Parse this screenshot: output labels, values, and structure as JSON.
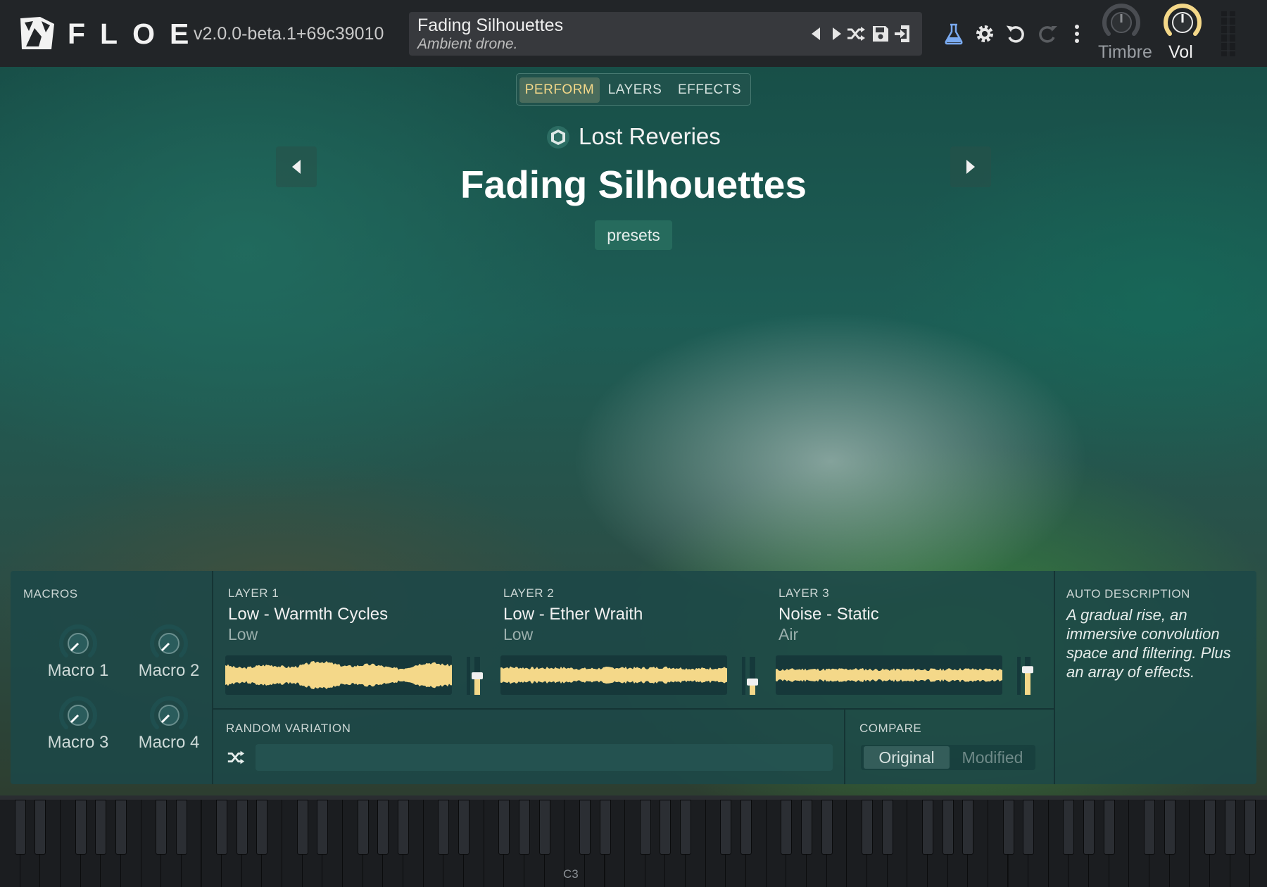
{
  "app": {
    "logo_text": "FLOE",
    "version": "v2.0.0-beta.1+69c39010"
  },
  "preset": {
    "name": "Fading Silhouettes",
    "description": "Ambient drone."
  },
  "toolbar_icons": [
    "triangle-left-icon",
    "triangle-right-icon",
    "shuffle-icon",
    "save-icon",
    "import-icon",
    "flask-icon",
    "gear-icon",
    "undo-icon",
    "redo-icon",
    "more-vertical-icon"
  ],
  "top_knobs": [
    {
      "label": "Timbre",
      "active": false
    },
    {
      "label": "Vol",
      "active": true
    }
  ],
  "tabs": [
    {
      "label": "PERFORM",
      "selected": true
    },
    {
      "label": "LAYERS",
      "selected": false
    },
    {
      "label": "EFFECTS",
      "selected": false
    }
  ],
  "hero": {
    "library": "Lost Reveries",
    "title": "Fading Silhouettes",
    "presets_label": "presets"
  },
  "macros": {
    "label": "MACROS",
    "items": [
      "Macro 1",
      "Macro 2",
      "Macro 3",
      "Macro 4"
    ]
  },
  "layers": [
    {
      "label": "LAYER 1",
      "name": "Low - Warmth Cycles",
      "sub": "Low",
      "level": 0.5
    },
    {
      "label": "LAYER 2",
      "name": "Low - Ether Wraith",
      "sub": "Low",
      "level": 0.3
    },
    {
      "label": "LAYER 3",
      "name": "Noise - Static",
      "sub": "Air",
      "level": 0.7
    }
  ],
  "random_variation": {
    "label": "RANDOM VARIATION"
  },
  "compare": {
    "label": "COMPARE",
    "original": "Original",
    "modified": "Modified"
  },
  "auto_description": {
    "label": "AUTO DESCRIPTION",
    "text": "A gradual rise, an immersive convolution space and filtering. Plus an array of effects."
  },
  "keyboard": {
    "marker": "C3"
  },
  "colors": {
    "accent": "#f4d889",
    "panel": "#1c4848",
    "topbar": "#222528",
    "flask": "#7aaaf0"
  }
}
